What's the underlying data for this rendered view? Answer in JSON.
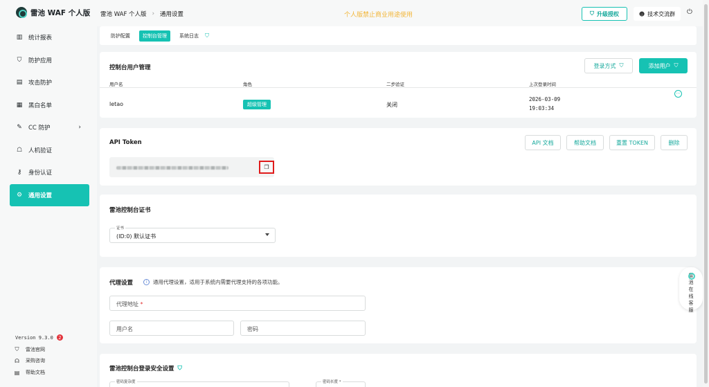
{
  "app": {
    "name": "雷池 WAF 个人版",
    "version": "Version 9.3.0",
    "version_badge": "2"
  },
  "sidebar": {
    "items": [
      {
        "label": "统计报表",
        "icon": "bar-chart-icon"
      },
      {
        "label": "防护应用",
        "icon": "shield-icon"
      },
      {
        "label": "攻击防护",
        "icon": "document-icon"
      },
      {
        "label": "黑白名单",
        "icon": "list-icon"
      },
      {
        "label": "CC 防护",
        "icon": "tools-icon",
        "arrow": "›"
      },
      {
        "label": "人机验证",
        "icon": "robot-icon"
      },
      {
        "label": "身份认证",
        "icon": "key-icon"
      },
      {
        "label": "通用设置",
        "icon": "settings-icon",
        "active": true
      }
    ],
    "links": [
      {
        "label": "雷池官网",
        "icon": "shield-icon"
      },
      {
        "label": "采购咨询",
        "icon": "headset-icon"
      },
      {
        "label": "帮助文档",
        "icon": "doc-icon"
      }
    ]
  },
  "topbar": {
    "breadcrumb": [
      "雷池 WAF 个人版",
      "通用设置"
    ],
    "notice": "个人版禁止商业用途使用",
    "upgrade_label": "升级授权",
    "tech_label": "技术交流群"
  },
  "tabs": [
    {
      "label": "防护配置"
    },
    {
      "label": "控制台管理",
      "active": true
    },
    {
      "label": "系统日志"
    }
  ],
  "users": {
    "title": "控制台用户管理",
    "login_method_label": "登录方式",
    "add_user_label": "添加用户",
    "columns": [
      "用户名",
      "角色",
      "二步验证",
      "上次登录时间"
    ],
    "rows": [
      {
        "username": "letao",
        "role": "超级管理",
        "two_factor": "关闭",
        "last_login_date": "2026-03-09",
        "last_login_time": "19:03:34"
      }
    ]
  },
  "api_token": {
    "title": "API Token",
    "buttons": [
      "API 文档",
      "帮助文档",
      "重置 TOKEN",
      "删除"
    ]
  },
  "certificate": {
    "title": "雷池控制台证书",
    "field_label": "证书",
    "value": "(ID:0) 默认证书"
  },
  "proxy": {
    "title": "代理设置",
    "info": "通用代理设置，适用于系统内需要代理支持的各项功能。",
    "address_placeholder": "代理地址",
    "required_mark": "*",
    "username_placeholder": "用户名",
    "password_placeholder": "密码"
  },
  "login_security": {
    "title": "雷池控制台登录安全设置",
    "complexity_label": "密码复杂度",
    "length_label": "密码长度 *"
  },
  "float_help": {
    "label": "雷池在线客服"
  },
  "colors": {
    "accent": "#16c2b3",
    "notice": "#f2b63a",
    "danger": "#e01b1b"
  }
}
